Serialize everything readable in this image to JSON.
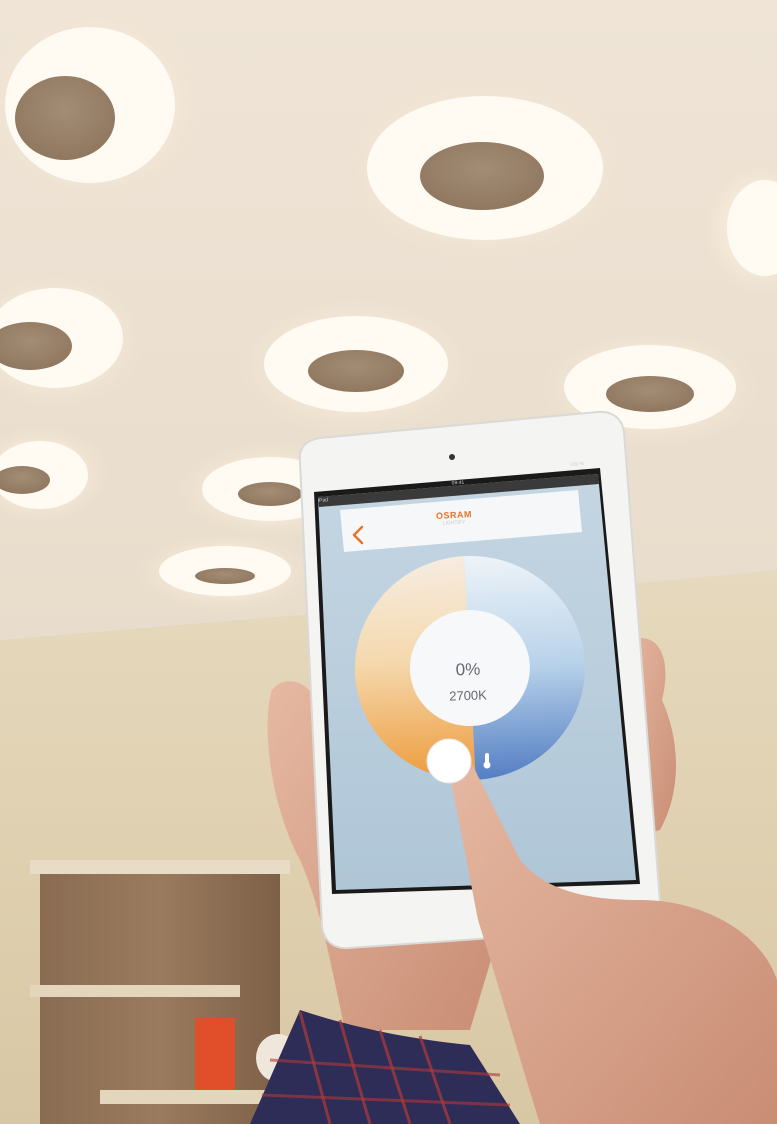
{
  "ios_status": {
    "carrier": "iPad",
    "time": "09:41",
    "battery": "100 %"
  },
  "app_header": {
    "brand": "OSRAM",
    "subtitle": "LIGHTIFY",
    "back_icon": "chevron-left-icon"
  },
  "light_control": {
    "brightness_value": "0%",
    "color_temperature_value": "2700K",
    "temperature_icon": "thermometer-icon"
  },
  "colors": {
    "accent_orange": "#e8742a",
    "warm_white_arc": "#f1a34a",
    "cool_blue_arc": "#5f8ccd",
    "app_background": "#b9cfdf"
  }
}
